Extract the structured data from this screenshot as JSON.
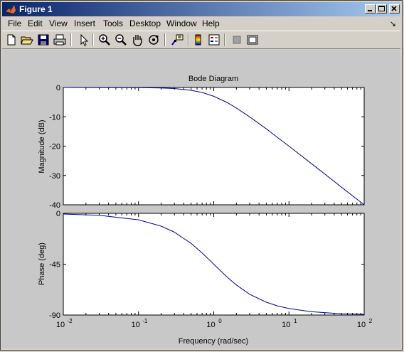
{
  "window": {
    "title": "Figure 1"
  },
  "menu": {
    "items": [
      "File",
      "Edit",
      "View",
      "Insert",
      "Tools",
      "Desktop",
      "Window",
      "Help"
    ],
    "dock_arrow": "↘"
  },
  "toolbar": {
    "buttons": [
      "new-file-icon",
      "open-folder-icon",
      "save-icon",
      "print-icon",
      "pointer-icon",
      "zoom-in-icon",
      "zoom-out-icon",
      "pan-hand-icon",
      "rotate-3d-icon",
      "data-cursor-icon",
      "colorbar-icon",
      "legend-icon",
      "hide-plot-tools-icon",
      "show-plot-tools-icon"
    ]
  },
  "chart_data": [
    {
      "type": "line",
      "title": "Bode Diagram",
      "ylabel": "Magnitude (dB)",
      "xscale": "log",
      "xlim": [
        0.01,
        100
      ],
      "ylim": [
        -40,
        0
      ],
      "yticks": [
        0,
        -10,
        -20,
        -30,
        -40
      ],
      "grid": false,
      "x": [
        0.01,
        0.1,
        0.2,
        0.3,
        0.5,
        0.7,
        1,
        1.5,
        2,
        3,
        5,
        7,
        10,
        20,
        30,
        50,
        100
      ],
      "values": [
        0,
        -0.04,
        -0.17,
        -0.37,
        -0.97,
        -1.7,
        -3.0,
        -5.1,
        -7.0,
        -10.0,
        -14.1,
        -17.0,
        -20.0,
        -26.0,
        -29.5,
        -34.0,
        -40.0
      ],
      "color": "#0000a0"
    },
    {
      "type": "line",
      "ylabel": "Phase (deg)",
      "xlabel": "Frequency (rad/sec)",
      "xscale": "log",
      "xlim": [
        0.01,
        100
      ],
      "ylim": [
        -90,
        0
      ],
      "yticks": [
        0,
        -45,
        -90
      ],
      "xticks": [
        "10",
        "10",
        "10",
        "10",
        "10"
      ],
      "xtick_exponents": [
        "-2",
        "-1",
        "0",
        "1",
        "2"
      ],
      "grid": false,
      "x": [
        0.01,
        0.03,
        0.1,
        0.2,
        0.3,
        0.5,
        0.7,
        1,
        1.5,
        2,
        3,
        5,
        7,
        10,
        20,
        50,
        100
      ],
      "values": [
        -0.6,
        -1.7,
        -5.7,
        -11.3,
        -16.7,
        -26.6,
        -35.0,
        -45.0,
        -56.3,
        -63.4,
        -71.6,
        -78.7,
        -81.9,
        -84.3,
        -87.1,
        -88.9,
        -89.4
      ],
      "color": "#0000a0"
    }
  ]
}
